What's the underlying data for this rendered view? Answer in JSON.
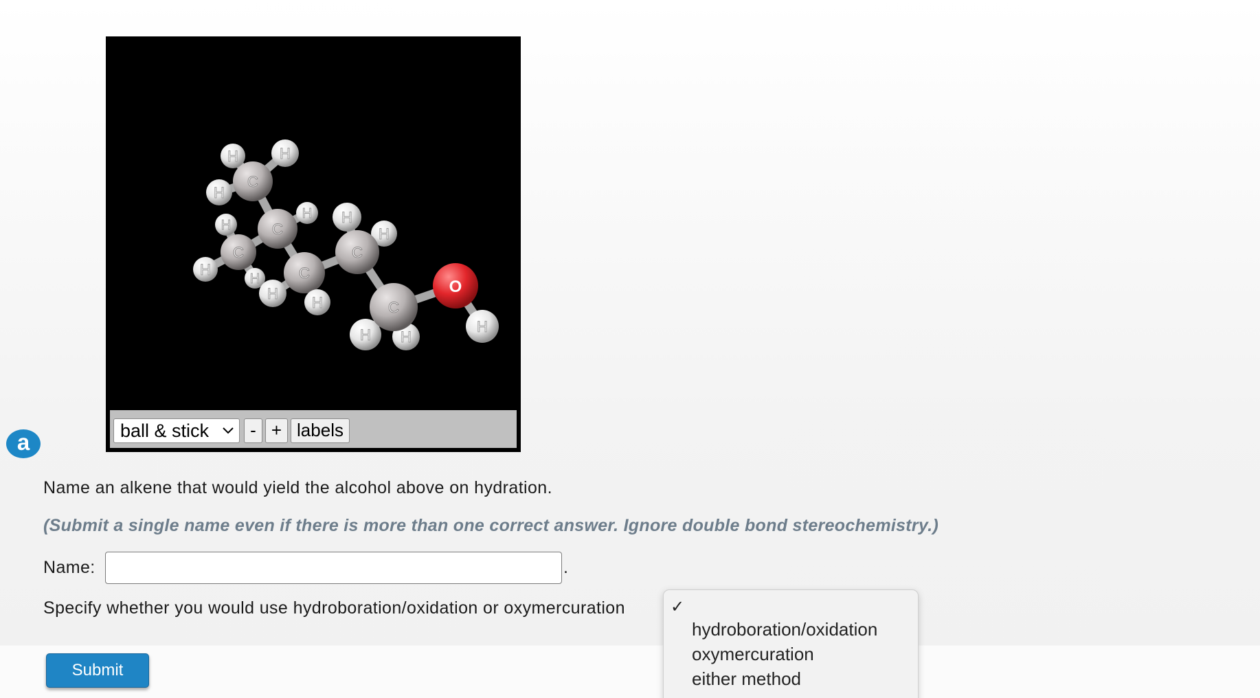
{
  "viewer": {
    "style_select": "ball & stick",
    "zoom_out_label": "-",
    "zoom_in_label": "+",
    "labels_button": "labels",
    "atom_labels": {
      "carbon": "C",
      "hydrogen": "H",
      "oxygen": "O"
    }
  },
  "part": {
    "badge": "a"
  },
  "question": {
    "prompt": "Name an alkene that would yield the alcohol above on hydration.",
    "hint": "(Submit a single name even if there is more than one correct answer. Ignore double bond stereochemistry.)",
    "name_label": "Name:",
    "name_value": "",
    "period": ".",
    "specify_text": "Specify whether you would use hydroboration/oxidation or oxymercuration"
  },
  "method_dropdown": {
    "checkmark": "✓",
    "selected": "",
    "options": [
      "hydroboration/oxidation",
      "oxymercuration",
      "either method"
    ]
  },
  "submit_label": "Submit"
}
